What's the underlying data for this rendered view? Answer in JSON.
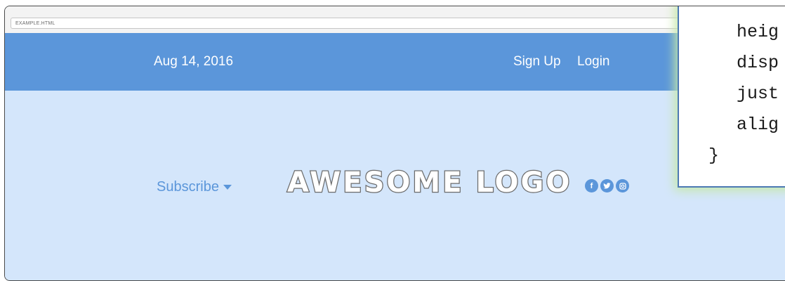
{
  "browser": {
    "url": "EXAMPLE.HTML"
  },
  "header": {
    "date": "Aug 14, 2016",
    "nav": [
      {
        "label": "Sign Up"
      },
      {
        "label": "Login"
      }
    ]
  },
  "hero": {
    "subscribe_label": "Subscribe",
    "logo_text": "AWESOME LOGO",
    "social_icons": [
      "facebook-icon",
      "twitter-icon",
      "instagram-icon"
    ]
  },
  "code_overlay": {
    "lines": [
      "heig",
      "disp",
      "just",
      "alig",
      "}"
    ]
  },
  "colors": {
    "header_bg": "#5b96da",
    "hero_bg": "#d4e6fb",
    "logo_outline": "#6b6b6b",
    "panel_border": "#4c79b4",
    "panel_glow": "#c5e8a8"
  }
}
